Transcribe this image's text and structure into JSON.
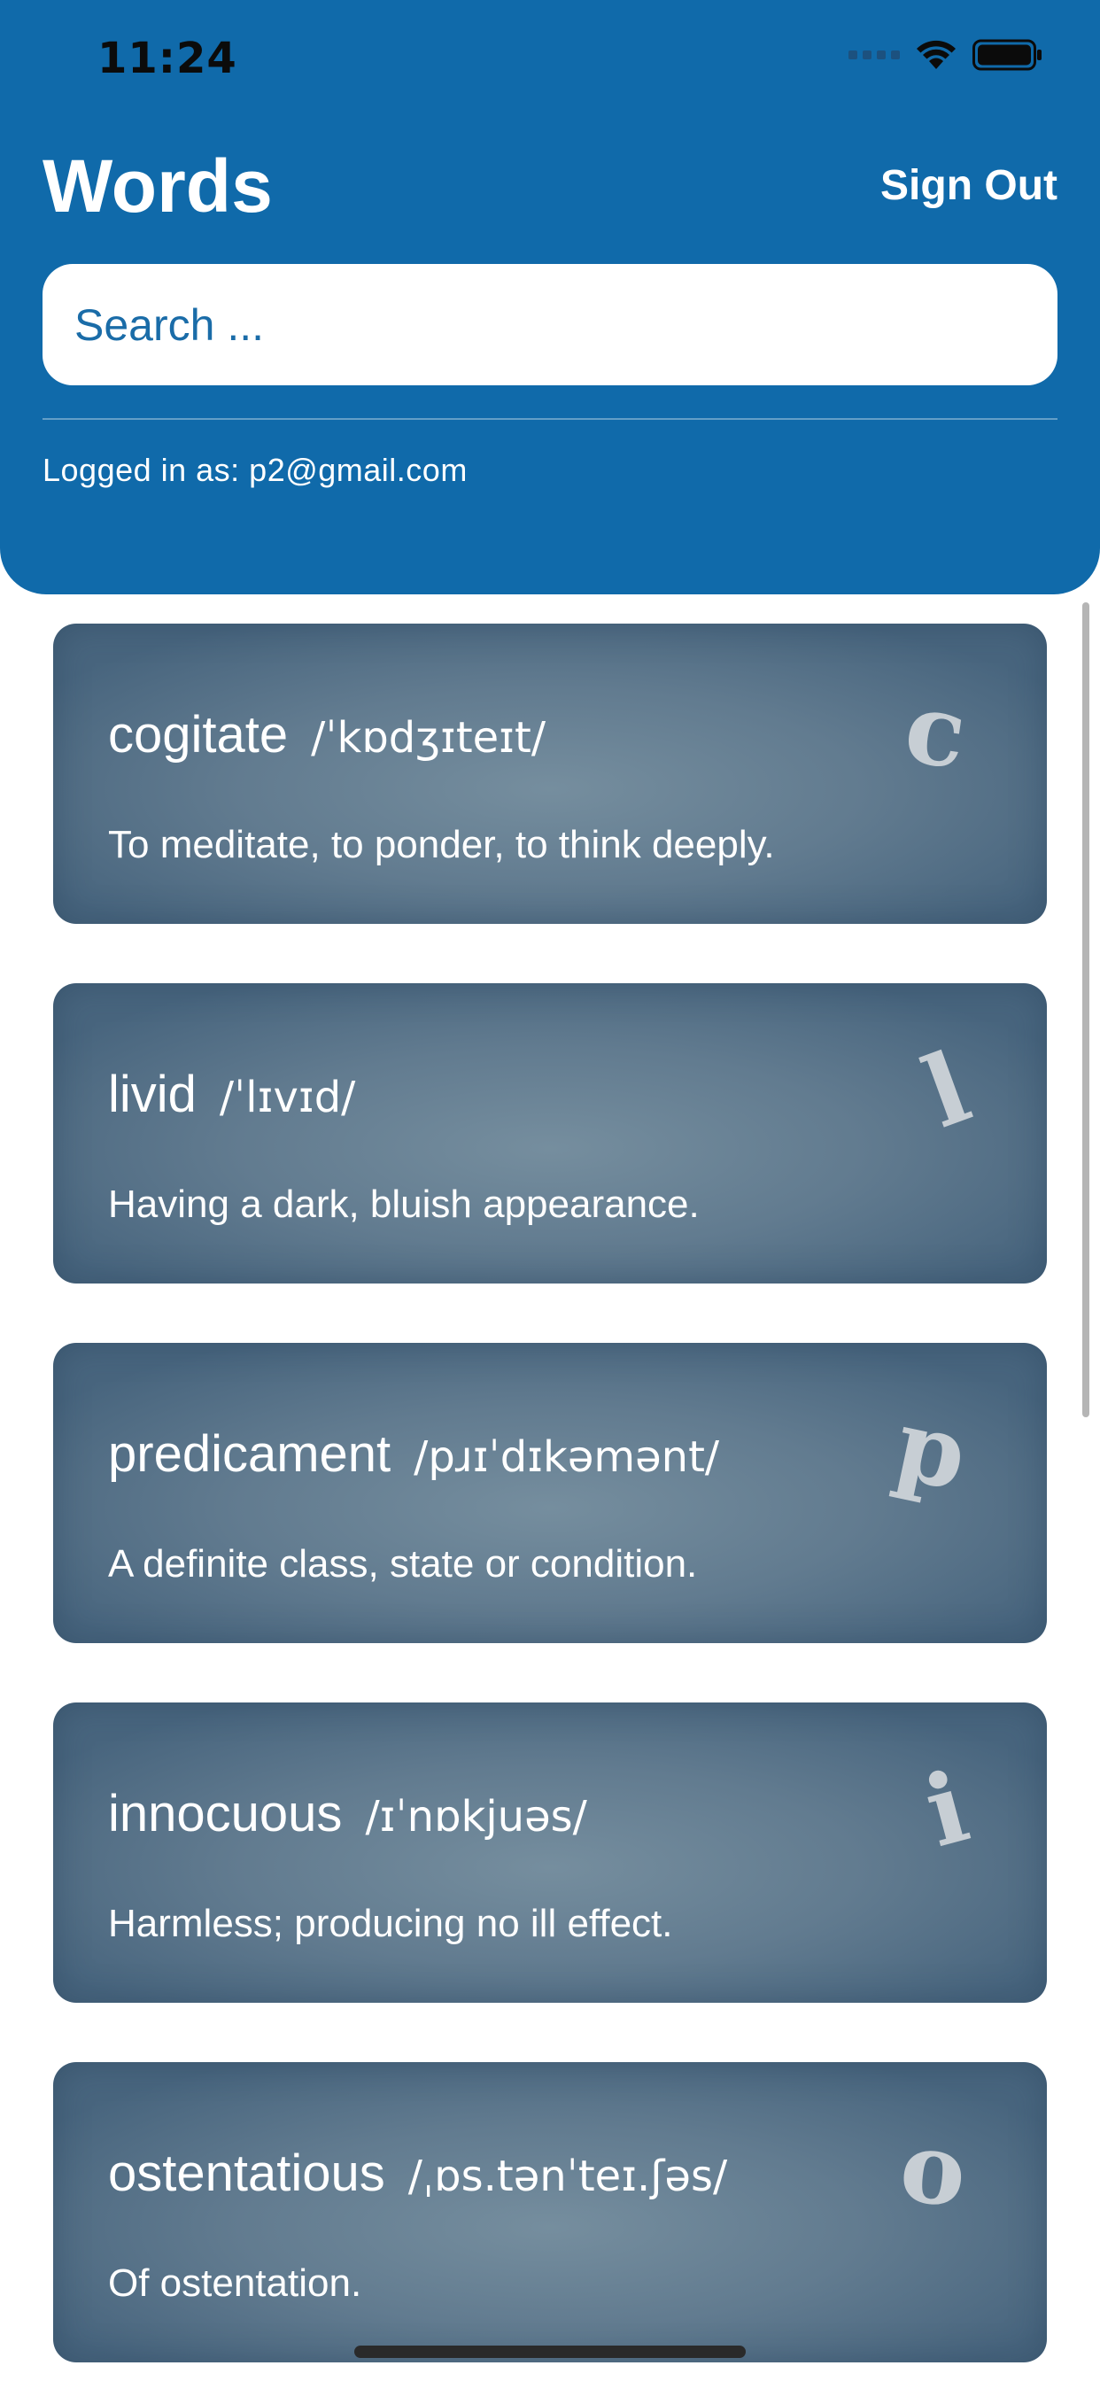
{
  "status_bar": {
    "time": "11:24"
  },
  "header": {
    "title": "Words",
    "sign_out_label": "Sign Out",
    "search_placeholder": "Search ...",
    "logged_in_text": "Logged in as: p2@gmail.com",
    "background_color": "#106aaa"
  },
  "cards": [
    {
      "word": "cogitate",
      "phonetic": "/ˈkɒdʒɪteɪt/",
      "definition": "To meditate, to ponder, to think deeply.",
      "letter": "c"
    },
    {
      "word": "livid",
      "phonetic": "/ˈlɪvɪd/",
      "definition": "Having a dark, bluish appearance.",
      "letter": "l"
    },
    {
      "word": "predicament",
      "phonetic": "/pɹɪˈdɪkəmənt/",
      "definition": "A definite class, state or condition.",
      "letter": "p"
    },
    {
      "word": "innocuous",
      "phonetic": "/ɪˈnɒkjuəs/",
      "definition": "Harmless; producing no ill effect.",
      "letter": "i"
    },
    {
      "word": "ostentatious",
      "phonetic": "/ˌɒs.tənˈteɪ.ʃəs/",
      "definition": "Of ostentation.",
      "letter": "o"
    }
  ],
  "icons": [
    "signal-icon",
    "wifi-icon",
    "battery-icon"
  ]
}
